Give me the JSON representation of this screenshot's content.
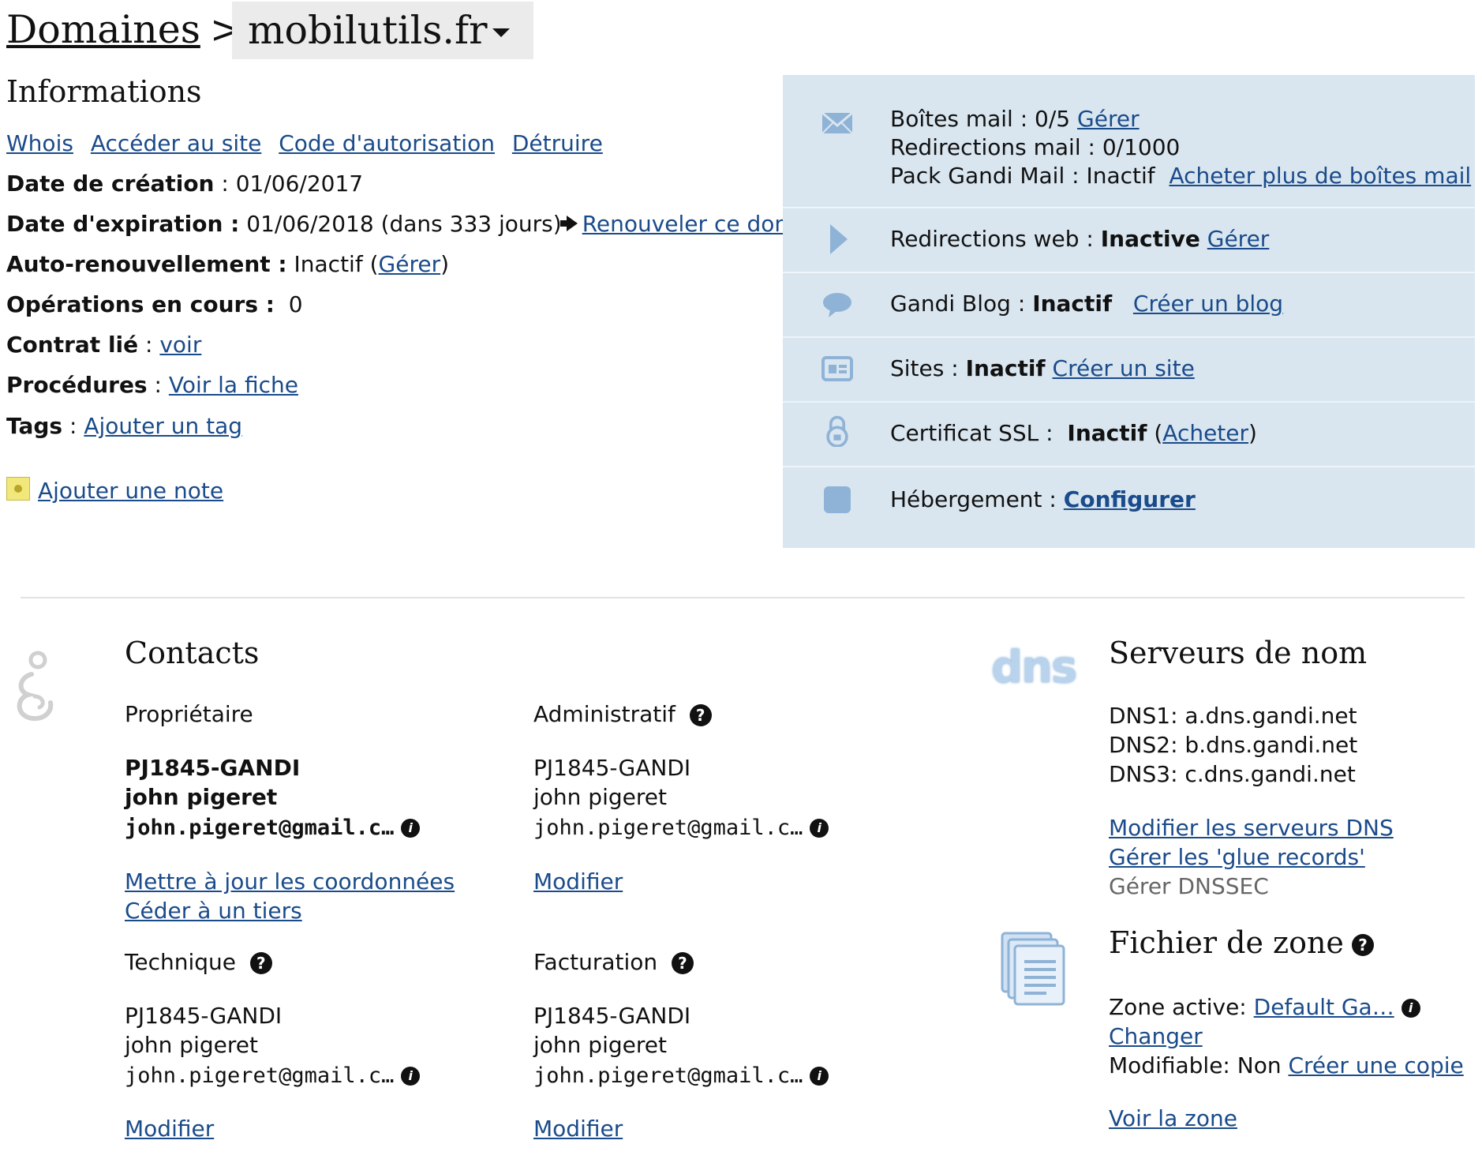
{
  "header": {
    "breadcrumb_root": "Domaines",
    "separator": ">",
    "domain": "mobilutils.fr"
  },
  "info": {
    "title": "Informations",
    "links": [
      "Whois",
      "Accéder au site",
      "Code d'autorisation",
      "Détruire"
    ],
    "creation_label": "Date de création",
    "creation_value": "01/06/2017",
    "expiration_label": "Date d'expiration :",
    "expiration_value": "01/06/2018 (dans 333 jours)",
    "renew_link": "Renouveler ce domaine",
    "autorenew_label": "Auto-renouvellement :",
    "autorenew_value": "Inactif (",
    "autorenew_link": "Gérer",
    "autorenew_close": ")",
    "ops_label": "Opérations en cours :",
    "ops_value": "0",
    "contract_label": "Contrat lié",
    "contract_link": "voir",
    "procedures_label": "Procédures",
    "procedures_link": "Voir la fiche",
    "tags_label": "Tags",
    "tags_link": "Ajouter un tag",
    "note_link": "Ajouter une note"
  },
  "services": {
    "mail_label": "Boîtes mail : 0/5",
    "mail_link": "Gérer",
    "redirections_mail": "Redirections mail : 0/1000",
    "pack_label": "Pack Gandi Mail : Inactif",
    "pack_link": "Acheter plus de boîtes mail",
    "web_label": "Redirections web :",
    "web_status": "Inactive",
    "web_link": "Gérer",
    "blog_label": "Gandi Blog :",
    "blog_status": "Inactif",
    "blog_link": "Créer un blog",
    "sites_label": "Sites :",
    "sites_status": "Inactif",
    "sites_link": "Créer un site",
    "ssl_label": "Certificat SSL :",
    "ssl_status": "Inactif",
    "ssl_open": "(",
    "ssl_link": "Acheter",
    "ssl_close": ")",
    "hosting_label": "Hébergement :",
    "hosting_link": "Configurer",
    "icon_color": "#8fb3d6"
  },
  "contacts": {
    "title": "Contacts",
    "owner": {
      "label": "Propriétaire",
      "handle": "PJ1845-GANDI",
      "name": "john pigeret",
      "email": "john.pigeret@gmail.c…",
      "link1": "Mettre à jour les coordonnées",
      "link2": "Céder à un tiers"
    },
    "admin": {
      "label": "Administratif",
      "handle": "PJ1845-GANDI",
      "name": "john pigeret",
      "email": "john.pigeret@gmail.c…",
      "link": "Modifier"
    },
    "tech": {
      "label": "Technique",
      "handle": "PJ1845-GANDI",
      "name": "john pigeret",
      "email": "john.pigeret@gmail.c…",
      "link": "Modifier"
    },
    "billing": {
      "label": "Facturation",
      "handle": "PJ1845-GANDI",
      "name": "john pigeret",
      "email": "john.pigeret@gmail.c…",
      "link": "Modifier"
    }
  },
  "dns": {
    "logo_text": "dns",
    "title": "Serveurs de nom",
    "ns": [
      "DNS1: a.dns.gandi.net",
      "DNS2: b.dns.gandi.net",
      "DNS3: c.dns.gandi.net"
    ],
    "modify_link": "Modifier les serveurs DNS",
    "glue_link": "Gérer les 'glue records'",
    "dnssec": "Gérer DNSSEC"
  },
  "zone": {
    "title": "Fichier de zone",
    "active_label": "Zone active:",
    "active_value": "Default Ga…",
    "change_link": "Changer",
    "modifiable_label": "Modifiable: Non",
    "copy_link": "Créer une copie",
    "view_link": "Voir la zone"
  },
  "glyphs": {
    "question": "?",
    "info": "i"
  }
}
